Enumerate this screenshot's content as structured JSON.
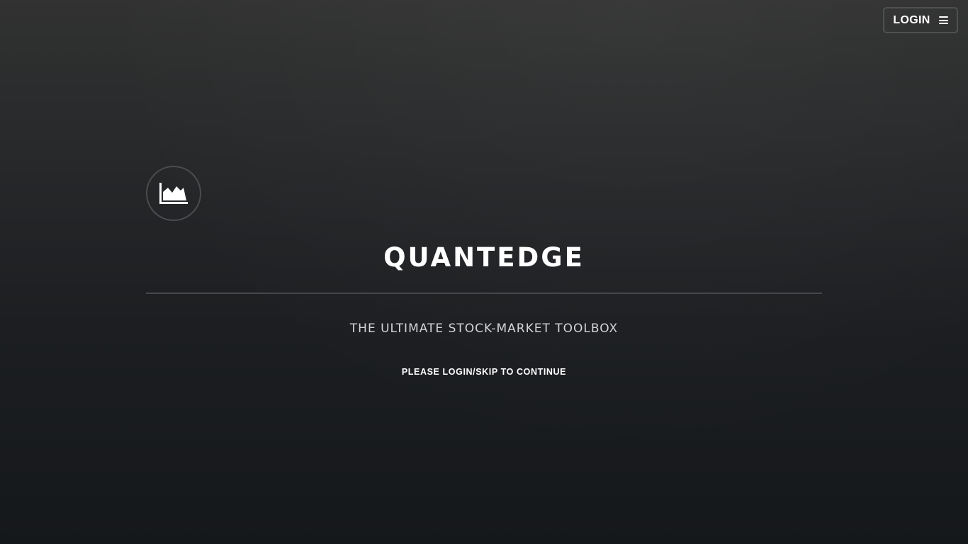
{
  "header": {
    "login_label": "LOGIN",
    "menu_icon": "hamburger-menu-icon"
  },
  "hero": {
    "logo_icon": "area-chart-icon",
    "title": "QUANTEDGE",
    "subtitle": "THE ULTIMATE STOCK-MARKET TOOLBOX",
    "call_to_action": "PLEASE LOGIN/SKIP TO CONTINUE"
  },
  "colors": {
    "background_top": "#313231",
    "background_bottom": "#15181b",
    "text": "#ffffff",
    "border": "#4e5052"
  }
}
